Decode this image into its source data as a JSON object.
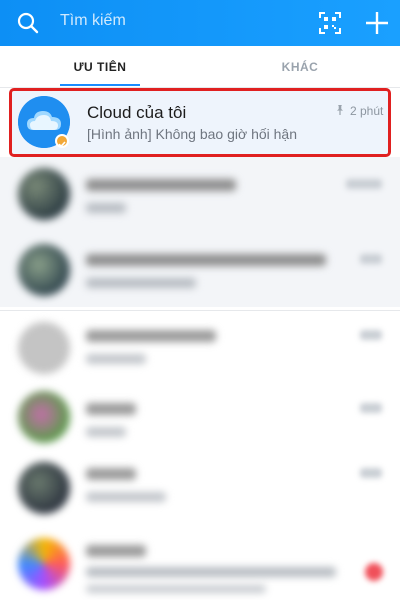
{
  "search": {
    "placeholder": "Tìm kiếm"
  },
  "tabs": [
    {
      "label": "ƯU TIÊN",
      "active": true
    },
    {
      "label": "KHÁC",
      "active": false
    }
  ],
  "conversations": [
    {
      "title": "Cloud của tôi",
      "preview": "[Hình ảnh] Không bao giờ hối hận",
      "time": "2 phút",
      "pinned": true,
      "highlighted": true,
      "avatar_icon": "cloud-icon"
    }
  ],
  "colors": {
    "header_gradient_start": "#0d8ff5",
    "header_gradient_end": "#1aa0ff",
    "active_tab_underline": "#1a8cff",
    "highlight_border": "#e02020",
    "badge": "#f2a838"
  },
  "icons": {
    "search": "search-icon",
    "qr": "qr-code-icon",
    "add": "plus-icon",
    "pin": "pin-icon"
  }
}
